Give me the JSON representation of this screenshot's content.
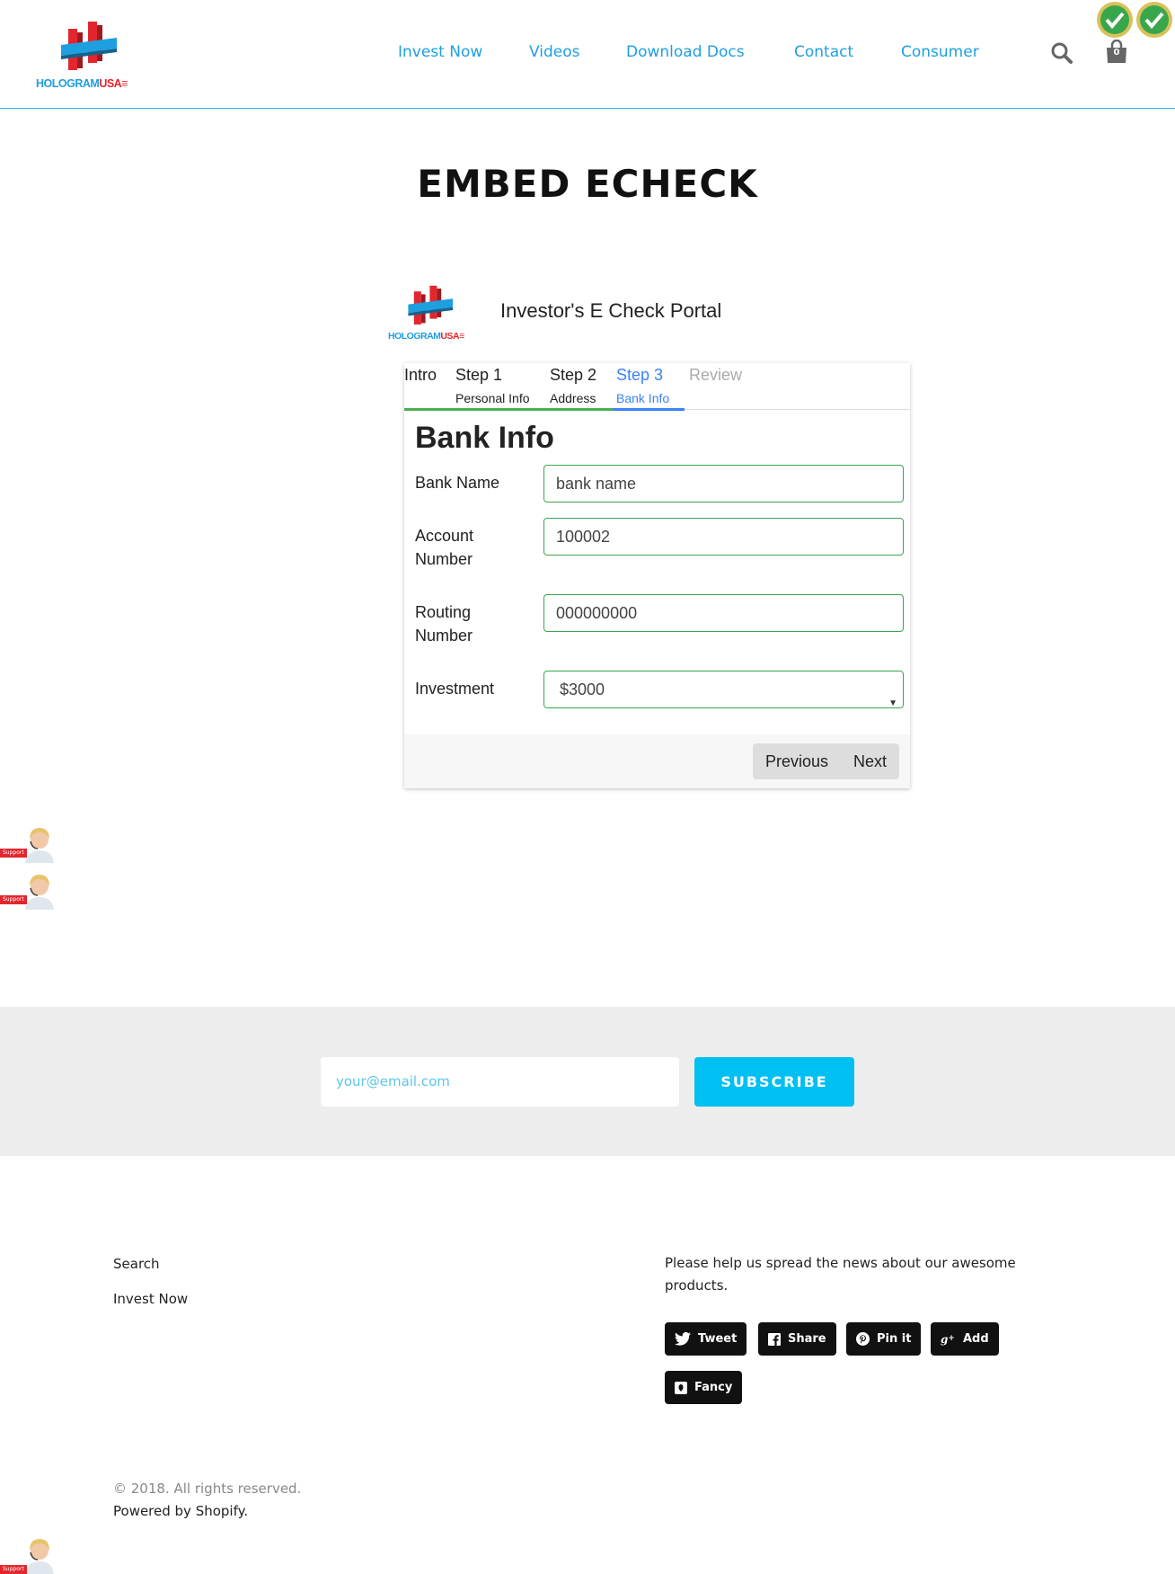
{
  "brand": {
    "logo_text_a": "HOLOGRAM",
    "logo_text_b": "USA"
  },
  "nav": {
    "items": [
      "Invest Now",
      "Videos",
      "Download Docs",
      "Contact",
      "Consumer"
    ]
  },
  "header": {
    "search_icon": "search-icon",
    "cart_icon": "shopping-bag-icon",
    "cart_count": "0"
  },
  "page": {
    "title": "EMBED ECHECK"
  },
  "portal": {
    "title": "Investor's E Check Portal",
    "steps": [
      {
        "title": "Intro",
        "subtitle": ""
      },
      {
        "title": "Step 1",
        "subtitle": "Personal Info"
      },
      {
        "title": "Step 2",
        "subtitle": "Address"
      },
      {
        "title": "Step 3",
        "subtitle": "Bank Info"
      },
      {
        "title": "Review",
        "subtitle": ""
      }
    ],
    "form_title": "Bank Info",
    "fields": {
      "bank_name": {
        "label": "Bank Name",
        "value": "bank name"
      },
      "account_number": {
        "label": "Account Number",
        "value": "100002"
      },
      "routing_number": {
        "label": "Routing Number",
        "value": "000000000"
      },
      "investment": {
        "label": "Investment",
        "value": "$3000"
      }
    },
    "buttons": {
      "previous": "Previous",
      "next": "Next"
    }
  },
  "support": {
    "label": "Support"
  },
  "newsletter": {
    "placeholder": "your@email.com",
    "button": "SUBSCRIBE"
  },
  "footer": {
    "links": [
      "Search",
      "Invest Now"
    ],
    "share_message": "Please help us spread the news about our awesome products.",
    "share_buttons": [
      "Tweet",
      "Share",
      "Pin it",
      "Add",
      "Fancy"
    ],
    "copyright": "© 2018. All rights reserved.",
    "powered_by": "Powered by Shopify."
  },
  "colors": {
    "accent": "#1e9fe0",
    "brand_red": "#e3262e",
    "active_step": "#3b82f6",
    "completed_step": "#4caf50",
    "subscribe": "#00bff3"
  }
}
